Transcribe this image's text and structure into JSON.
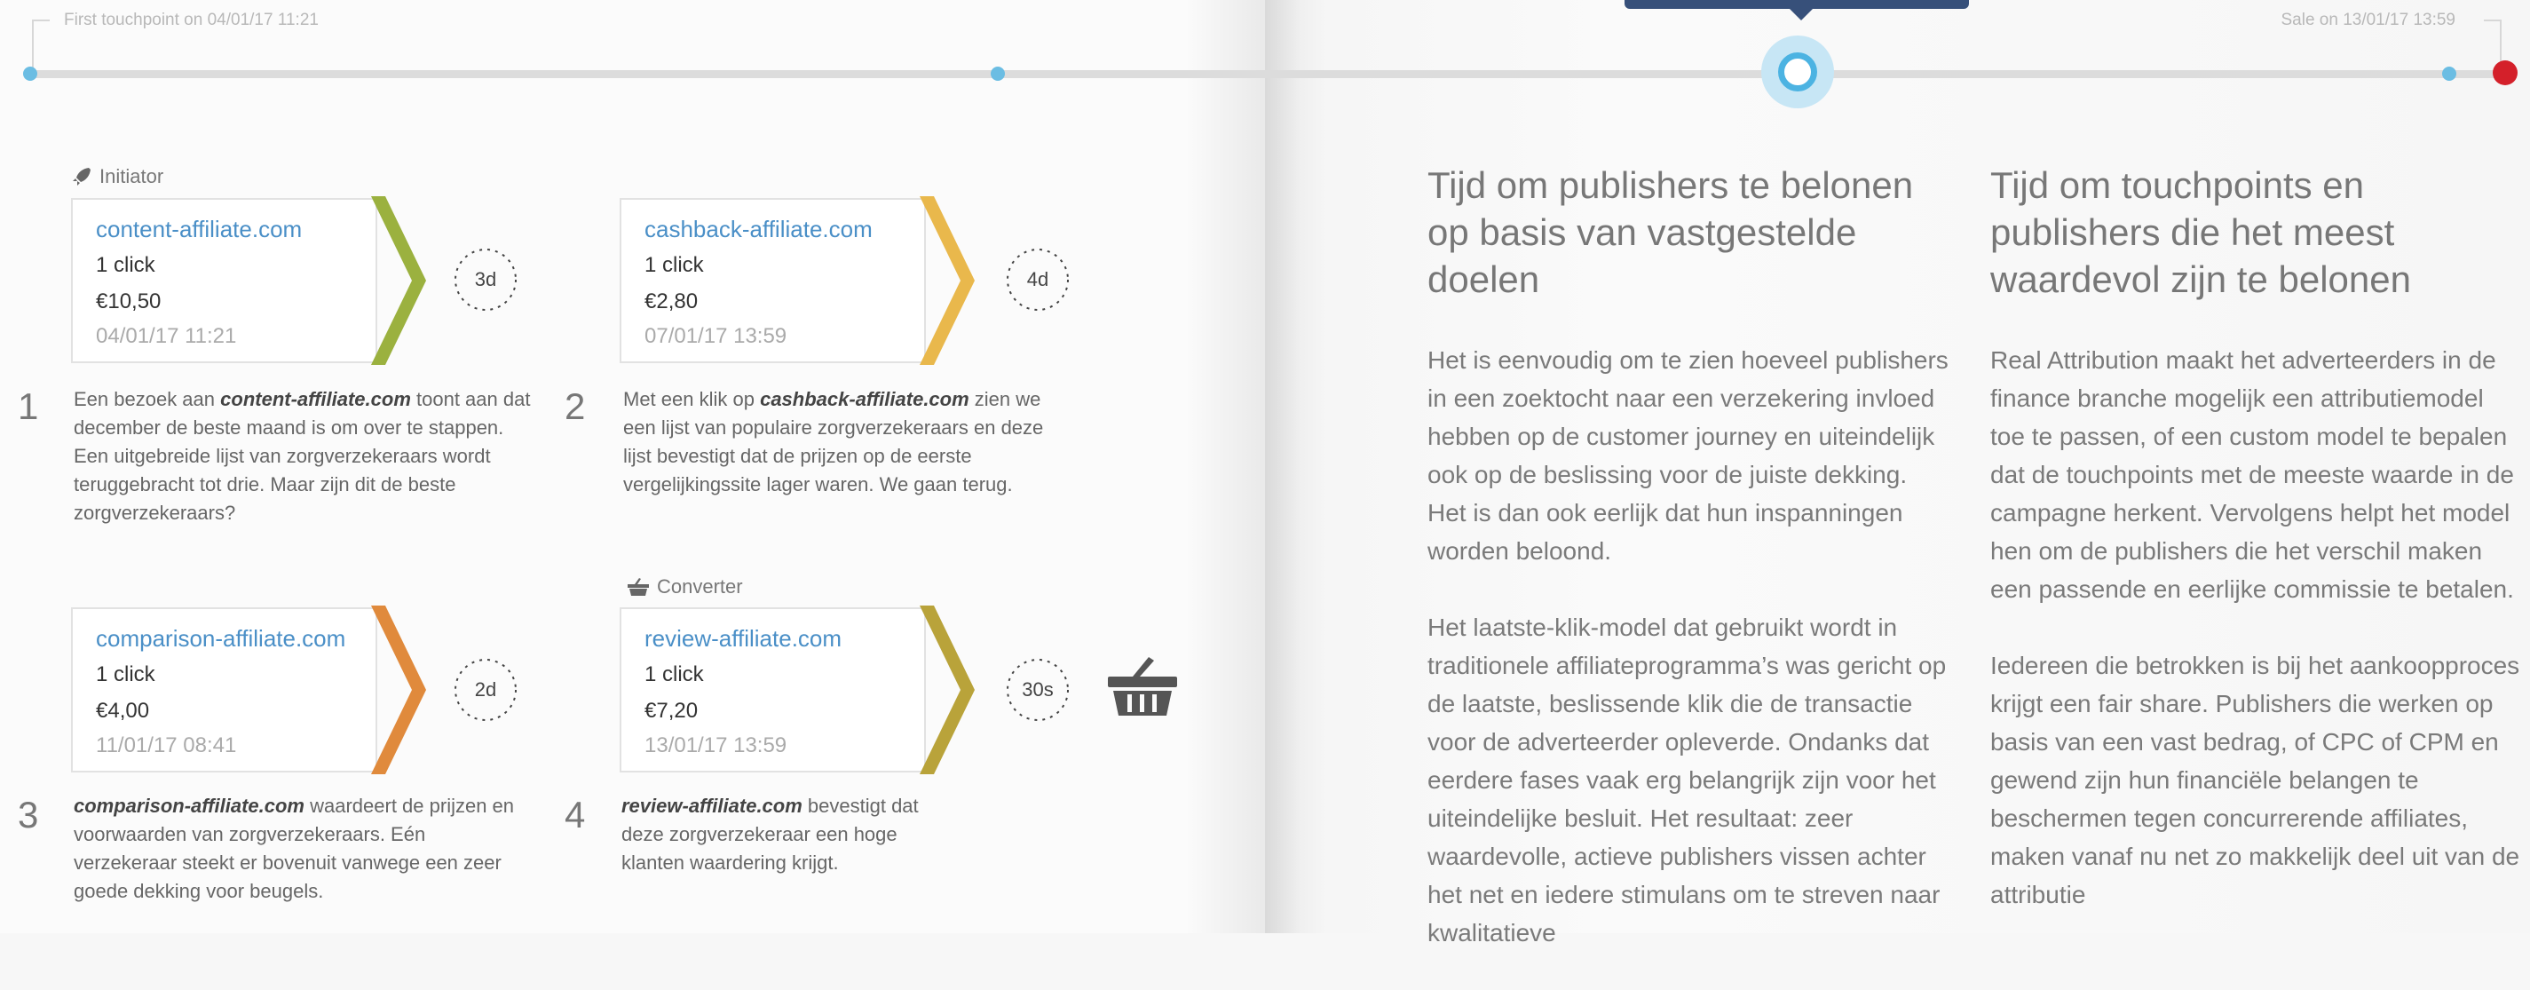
{
  "timeline": {
    "first_touchpoint": "First touchpoint on 04/01/17 11:21",
    "sale": "Sale on 13/01/17 13:59"
  },
  "steps": [
    {
      "role": "Initiator",
      "role_icon": "rocket-icon",
      "domain": "content-affiliate.com",
      "clicks": "1 click",
      "amount": "€10,50",
      "date": "04/01/17 11:21",
      "color": "#9bb13f",
      "gap": "3d",
      "number": "1",
      "text_bold": "content-affiliate.com",
      "text_before": "Een bezoek aan ",
      "text_after": " toont aan dat december de beste maand is om over te stappen. Een uitgebreide lijst van zorgverzekeraars wordt teruggebracht tot drie. Maar zijn dit de beste zorgverzekeraars?"
    },
    {
      "role": "",
      "domain": "cashback-affiliate.com",
      "clicks": "1 click",
      "amount": "€2,80",
      "date": "07/01/17 13:59",
      "color": "#e9b84c",
      "gap": "4d",
      "number": "2",
      "text_bold": "cashback-affiliate.com",
      "text_before": "Met een klik op ",
      "text_after": " zien we een lijst van populaire zorgverzekeraars en deze lijst bevestigt dat de prijzen op de eerste vergelijkingssite lager waren. We gaan terug."
    },
    {
      "role": "",
      "domain": "comparison-affiliate.com",
      "clicks": "1 click",
      "amount": "€4,00",
      "date": "11/01/17 08:41",
      "color": "#e08a3c",
      "gap": "2d",
      "number": "3",
      "text_bold": "comparison-affiliate.com",
      "text_before": "",
      "text_after": " waardeert de prijzen en voorwaarden van zorgverzekeraars. Eén verzekeraar steekt er bovenuit vanwege een zeer goede dekking voor beugels."
    },
    {
      "role": "Converter",
      "role_icon": "basket-icon",
      "domain": "review-affiliate.com",
      "clicks": "1 click",
      "amount": "€7,20",
      "date": "13/01/17 13:59",
      "color": "#b9a33a",
      "gap": "30s",
      "number": "4",
      "text_bold": "review-affiliate.com",
      "text_before": "",
      "text_after": " bevestigt dat deze zorgverzekeraar een hoge klanten waardering krijgt."
    }
  ],
  "columns": [
    {
      "title": "Tijd om publishers te belonen op basis van vastgestelde doelen",
      "paragraphs": [
        "Het is eenvoudig om te zien hoeveel publishers in een zoektocht naar een verzekering invloed hebben op de customer journey en uiteindelijk ook op de beslissing voor de juiste dekking. Het is dan ook eerlijk dat hun inspanningen worden beloond.",
        "Het laatste-klik-model dat gebruikt wordt in traditionele affiliateprogramma’s was gericht op de laatste, beslissende klik die de transactie voor de adverteerder opleverde. Ondanks dat eerdere fases vaak erg belangrijk zijn voor het uiteindelijke besluit. Het resultaat: zeer waardevolle, actieve publishers vissen achter het net en iedere stimulans om te streven naar kwalitatieve"
      ]
    },
    {
      "title": "Tijd om touchpoints en publishers die het meest waardevol zijn te belonen",
      "paragraphs": [
        "Real Attribution maakt het adverteerders in de finance branche mogelijk een attributiemodel toe te passen, of een custom model te bepalen dat de touchpoints met de meeste waarde in de campagne herkent. Vervolgens helpt het model hen om de publishers die het verschil maken een passende en eerlijke commissie te betalen.",
        "Iedereen die betrokken is bij het aankoopproces krijgt een fair share. Publishers die werken op basis van een vast bedrag, of CPC of CPM en gewend zijn hun financiële belangen te beschermen tegen concurrerende affiliates, maken vanaf nu net zo makkelijk deel uit van de attributie"
      ]
    }
  ]
}
